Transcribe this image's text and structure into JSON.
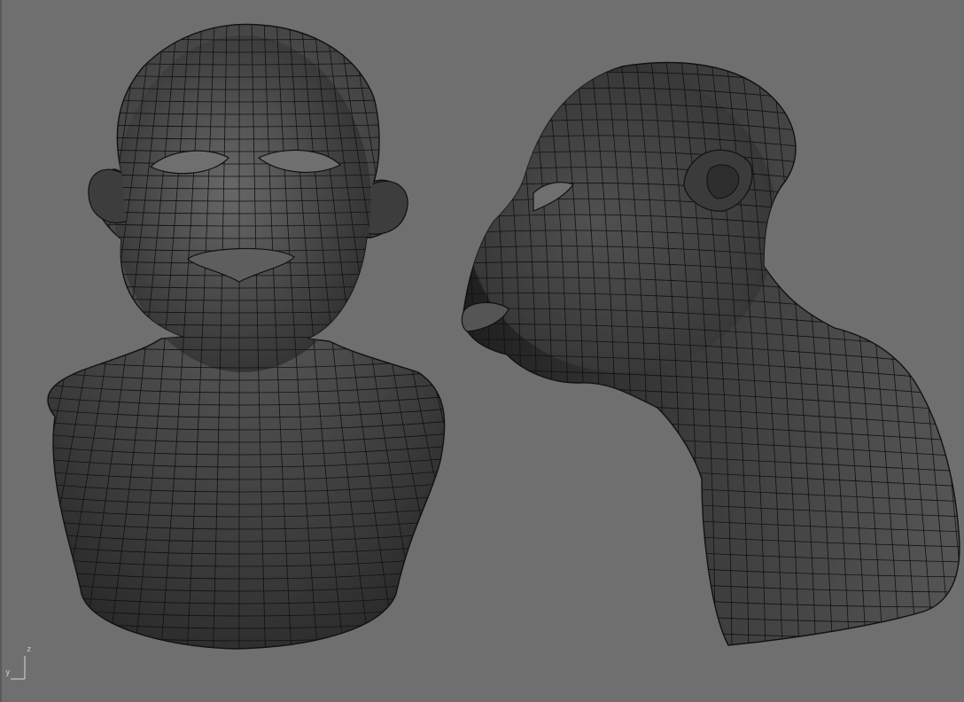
{
  "viewport": {
    "background": "#6f6f6f",
    "mesh_fill": "#4a4a4a",
    "wire_color": "#111111",
    "views": [
      "front",
      "side"
    ]
  },
  "axis_gizmo": {
    "z_label": "z",
    "y_label": "y"
  }
}
